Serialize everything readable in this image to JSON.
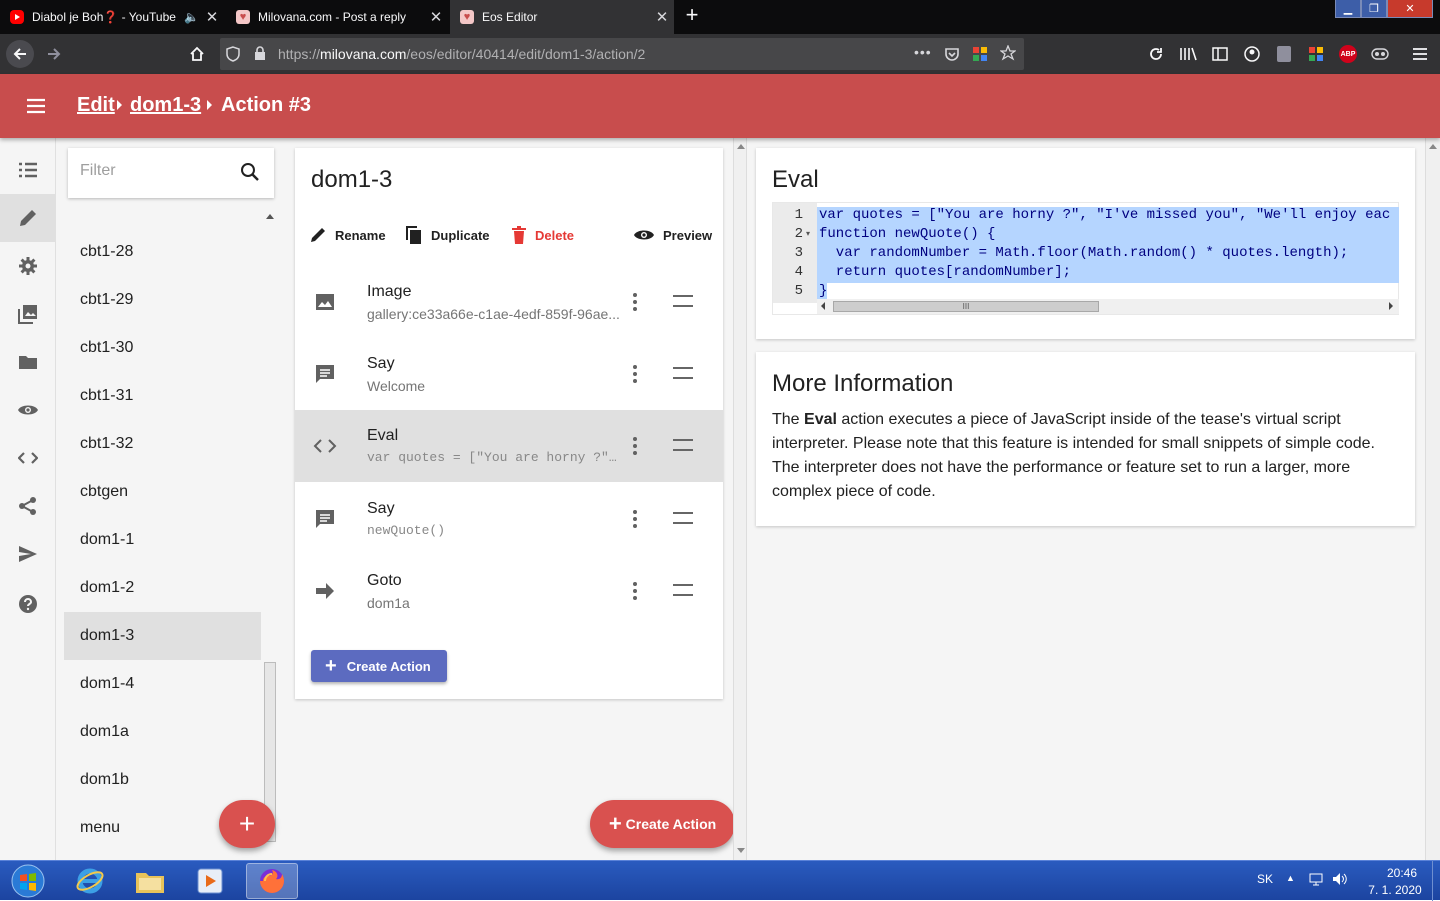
{
  "browser": {
    "tabs": [
      {
        "title": "Diabol je Boh❓ - YouTube",
        "audio_icon": "speaker-icon"
      },
      {
        "title": "Milovana.com - Post a reply"
      },
      {
        "title": "Eos Editor"
      }
    ],
    "url_prefix": "https://",
    "url_domain": "milovana.com",
    "url_path": "/eos/editor/40414/edit/dom1-3/action/2",
    "page_actions_glyph": "•••"
  },
  "header": {
    "crumbs": [
      "Edit",
      "dom1-3",
      "Action #3"
    ],
    "color": "#c84d4d"
  },
  "pages": {
    "filter_placeholder": "Filter",
    "items": [
      "cbt1-28",
      "cbt1-29",
      "cbt1-30",
      "cbt1-31",
      "cbt1-32",
      "cbtgen",
      "dom1-1",
      "dom1-2",
      "dom1-3",
      "dom1-4",
      "dom1a",
      "dom1b",
      "menu"
    ],
    "selected": "dom1-3",
    "fab_label": "+"
  },
  "page_panel": {
    "title": "dom1-3",
    "toolbar": {
      "rename": "Rename",
      "duplicate": "Duplicate",
      "delete": "Delete",
      "preview": "Preview"
    },
    "actions": [
      {
        "title": "Image",
        "subtitle": "gallery:ce33a66e-c1ae-4edf-859f-96ae...",
        "icon": "image-icon"
      },
      {
        "title": "Say",
        "subtitle": "Welcome",
        "icon": "message-icon"
      },
      {
        "title": "Eval",
        "subtitle": "var quotes = [\"You are horny ?\", \"I've missed you\", \"We'll enjoy each",
        "icon": "code-icon"
      },
      {
        "title": "Say",
        "subtitle": "newQuote()",
        "icon": "message-icon"
      },
      {
        "title": "Goto",
        "subtitle": "dom1a",
        "icon": "arrow-right-icon"
      }
    ],
    "create_action": "Create Action",
    "fab_create_action": "Create Action"
  },
  "eval": {
    "title": "Eval",
    "line_numbers": [
      "1",
      "2",
      "3",
      "4",
      "5"
    ],
    "code": [
      "var quotes = [\"You are horny ?\", \"I've missed you\", \"We'll enjoy eac",
      "function newQuote() {",
      "  var randomNumber = Math.floor(Math.random() * quotes.length);",
      "  return quotes[randomNumber];",
      "}"
    ],
    "scroll_grip": "III"
  },
  "info": {
    "title": "More Information",
    "text_before": "The ",
    "text_bold": "Eval",
    "text_after": " action executes a piece of JavaScript inside of the tease's virtual script interpreter. Please note that this feature is intended for small snippets of simple code. The interpreter does not have the performance or feature set to run a larger, more complex piece of code."
  },
  "taskbar": {
    "lang": "SK",
    "time": "20:46",
    "date": "7. 1. 2020"
  },
  "colors": {
    "accent": "#c84d4d",
    "fab": "#d9514f",
    "button": "#5c6bc0",
    "delete": "#e53935"
  }
}
